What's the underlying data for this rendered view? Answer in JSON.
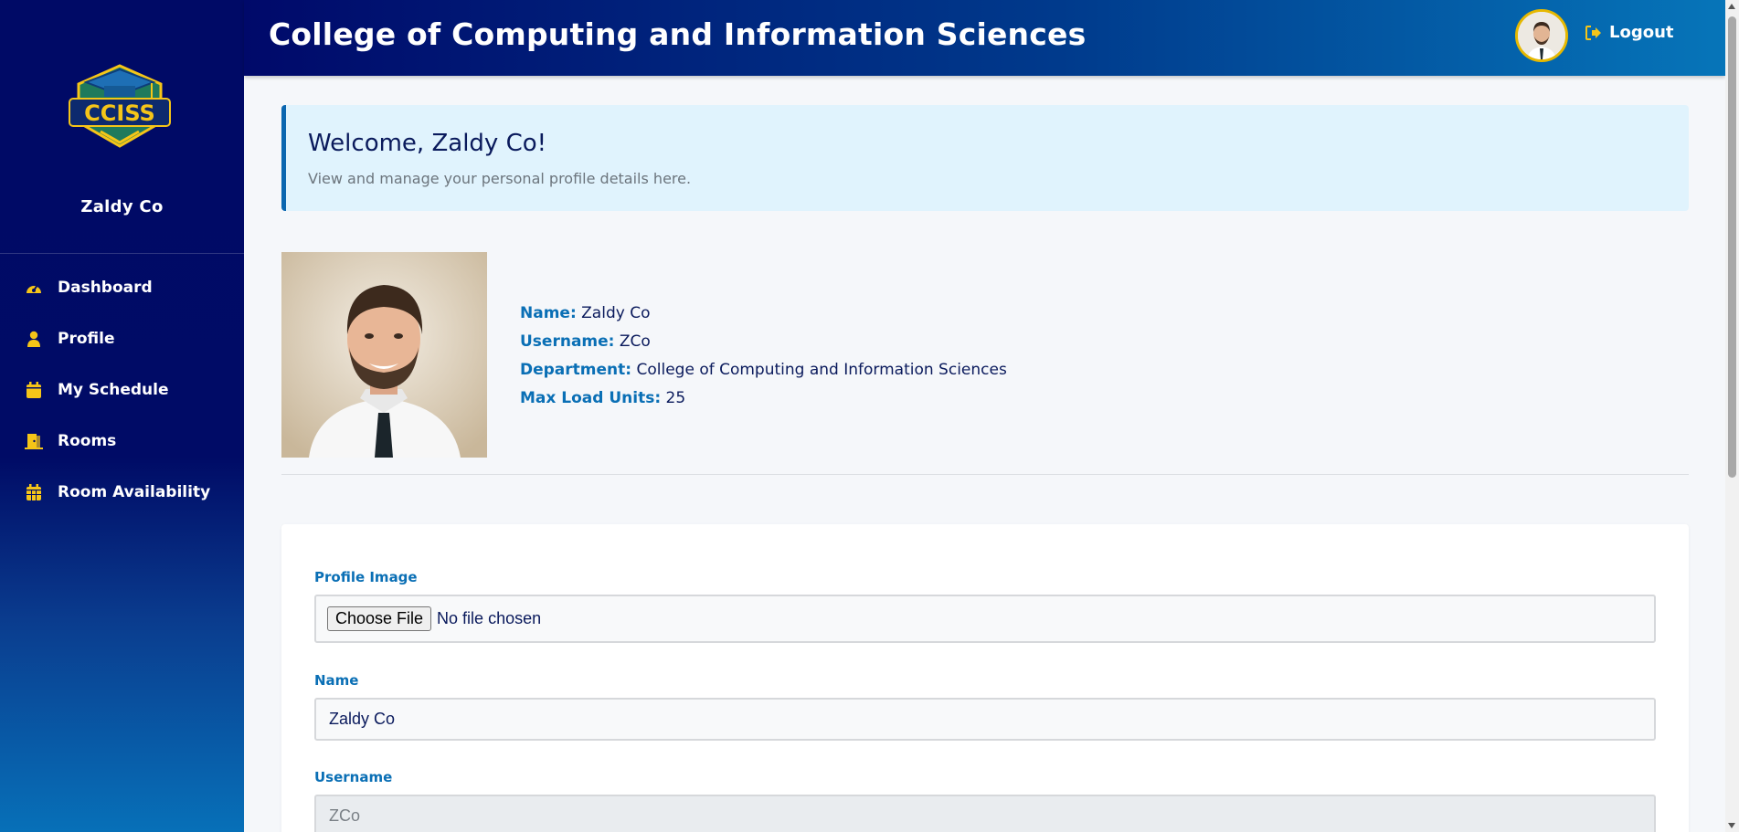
{
  "app": {
    "title": "College of Computing and Information Sciences"
  },
  "logo": {
    "text": "CCISS"
  },
  "sidebar": {
    "user_name": "Zaldy Co",
    "items": [
      {
        "label": "Dashboard",
        "icon": "gauge-icon"
      },
      {
        "label": "Profile",
        "icon": "user-icon"
      },
      {
        "label": "My Schedule",
        "icon": "calendar-icon"
      },
      {
        "label": "Rooms",
        "icon": "door-icon"
      },
      {
        "label": "Room Availability",
        "icon": "calendar-grid-icon"
      }
    ]
  },
  "header": {
    "logout_label": "Logout"
  },
  "welcome": {
    "title": "Welcome, Zaldy Co!",
    "subtitle": "View and manage your personal profile details here."
  },
  "profile": {
    "fields": [
      {
        "key": "Name:",
        "value": "Zaldy Co"
      },
      {
        "key": "Username:",
        "value": "ZCo"
      },
      {
        "key": "Department:",
        "value": "College of Computing and Information Sciences"
      },
      {
        "key": "Max Load Units:",
        "value": "25"
      }
    ]
  },
  "form": {
    "image_label": "Profile Image",
    "file_button": "Choose File",
    "file_status": "No file chosen",
    "name_label": "Name",
    "name_value": "Zaldy Co",
    "username_label": "Username",
    "username_value": "ZCo"
  },
  "colors": {
    "sidebar_bg": "#000b66",
    "accent_gold": "#f5c518",
    "label_blue": "#0a6fb5",
    "welcome_bg": "#e0f3fd"
  }
}
